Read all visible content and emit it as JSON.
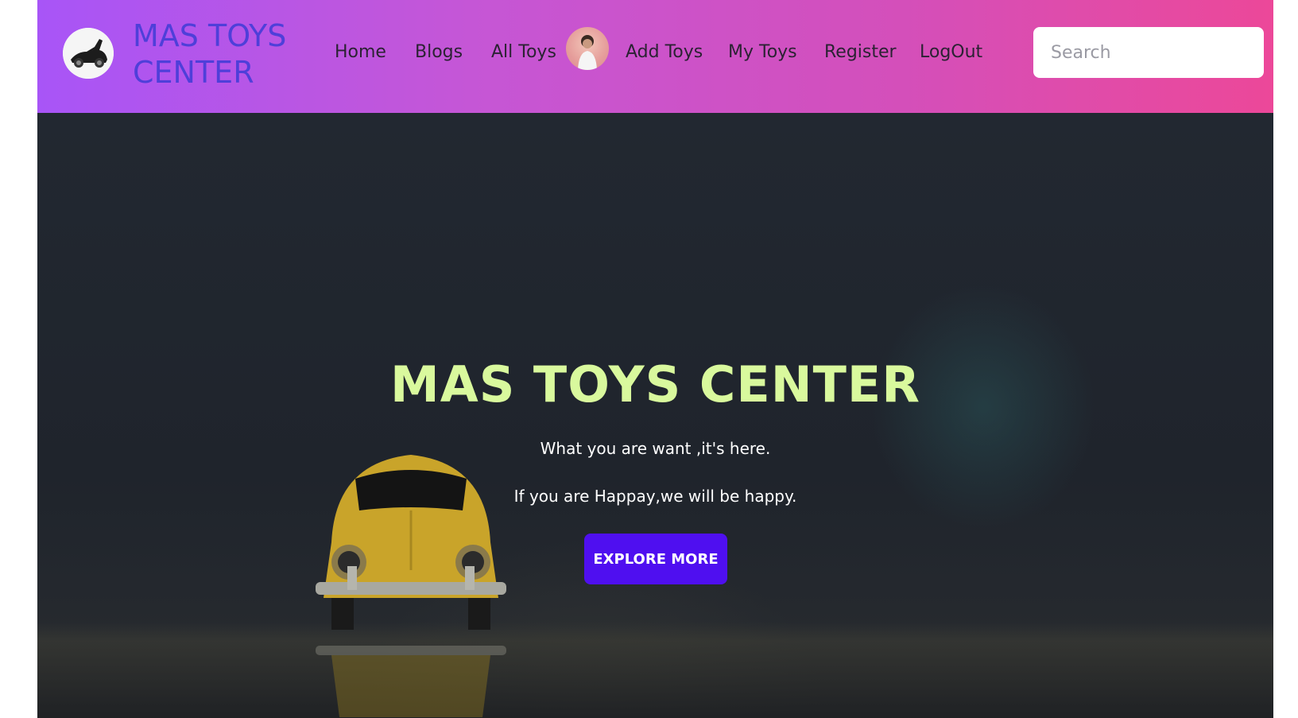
{
  "brand": {
    "name": "MAS TOYS CENTER",
    "logo_icon": "toy-car-logo-icon"
  },
  "nav": {
    "items": [
      {
        "label": "Home"
      },
      {
        "label": "Blogs"
      },
      {
        "label": "All Toys"
      },
      {
        "label": "Add Toys"
      },
      {
        "label": "My Toys"
      },
      {
        "label": "Register"
      },
      {
        "label": "LogOut"
      }
    ],
    "avatar_icon": "user-avatar-icon"
  },
  "search": {
    "placeholder": "Search",
    "value": ""
  },
  "hero": {
    "title": "MAS TOYS CENTER",
    "subtitle": "What you are want ,it's here.",
    "tagline": "If you are Happay,we will be happy.",
    "button_label": "EXPLORE MORE"
  },
  "colors": {
    "nav_gradient_start": "#a855f7",
    "nav_gradient_end": "#ec4899",
    "brand_text": "#4f3fd9",
    "hero_title": "#d9f99d",
    "button_bg": "#4f0ff0"
  }
}
